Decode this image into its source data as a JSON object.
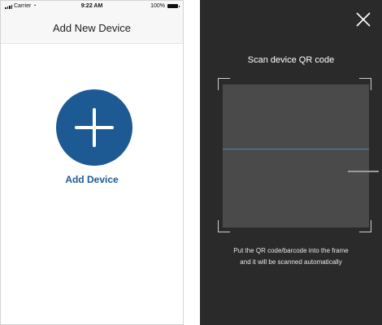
{
  "left_screen": {
    "status_bar": {
      "carrier": "Carrier",
      "time": "9:22 AM",
      "battery": "100%"
    },
    "nav": {
      "title": "Add New Device"
    },
    "add_device": {
      "label": "Add Device",
      "button_color": "#1d5a94"
    }
  },
  "right_screen": {
    "title": "Scan device QR code",
    "instructions": [
      "Put the QR code/barcode into the frame",
      "and it will be scanned automatically"
    ],
    "scan_line_color": "#4a87c6"
  },
  "icons": {
    "signal": "signal-bars-icon",
    "wifi": "wifi-icon",
    "battery": "battery-icon",
    "plus": "plus-icon",
    "close": "close-icon"
  }
}
